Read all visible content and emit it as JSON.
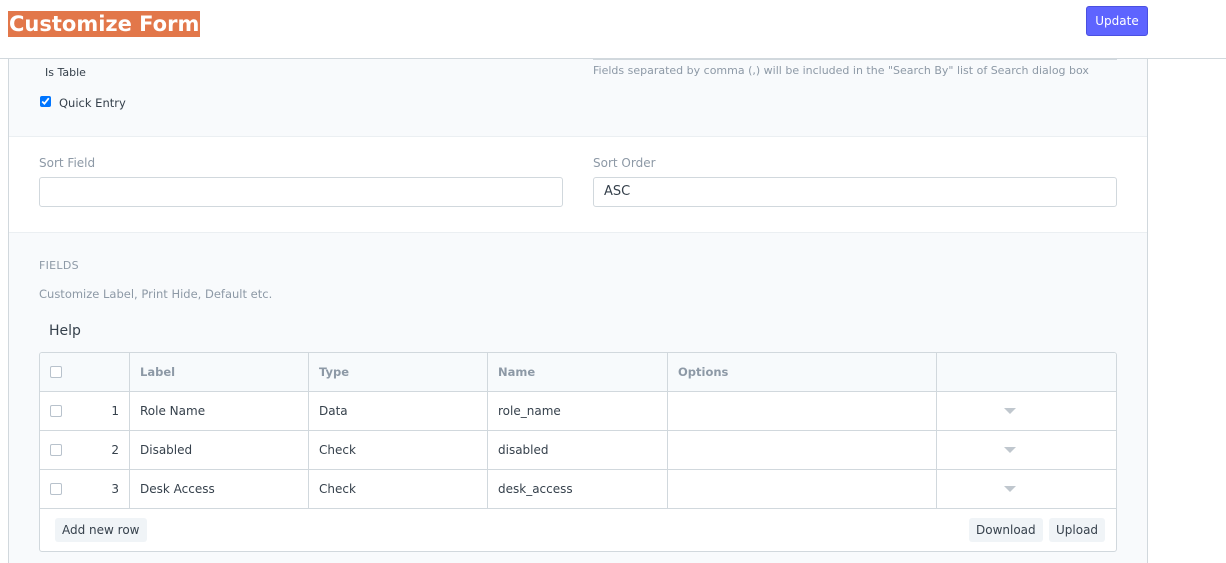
{
  "header": {
    "title": "Customize Form",
    "update_label": "Update"
  },
  "top_section": {
    "is_table_label": "Is Table",
    "search_help": "Fields separated by comma (,) will be included in the \"Search By\" list of Search dialog box",
    "quick_entry_label": "Quick Entry",
    "quick_entry_checked": true
  },
  "sort": {
    "sort_field_label": "Sort Field",
    "sort_field_value": "",
    "sort_order_label": "Sort Order",
    "sort_order_value": "ASC"
  },
  "fields_section": {
    "heading": "FIELDS",
    "description": "Customize Label, Print Hide, Default etc.",
    "help_label": "Help"
  },
  "grid": {
    "columns": [
      "Label",
      "Type",
      "Name",
      "Options"
    ],
    "rows": [
      {
        "idx": "1",
        "label": "Role Name",
        "type": "Data",
        "name": "role_name",
        "options": ""
      },
      {
        "idx": "2",
        "label": "Disabled",
        "type": "Check",
        "name": "disabled",
        "options": ""
      },
      {
        "idx": "3",
        "label": "Desk Access",
        "type": "Check",
        "name": "desk_access",
        "options": ""
      }
    ],
    "add_row_label": "Add new row",
    "download_label": "Download",
    "upload_label": "Upload"
  },
  "colors": {
    "title_bg": "#e2774a",
    "primary": "#5e64ff"
  }
}
